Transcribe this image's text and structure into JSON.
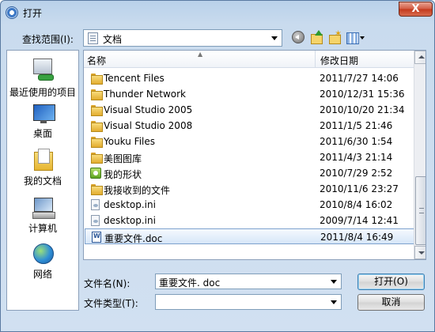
{
  "window": {
    "title": "打开",
    "close_label": "X"
  },
  "toolbar": {
    "look_in_label": "查找范围(I):",
    "look_in_value": "文档",
    "icons": [
      "back-icon",
      "up-folder-icon",
      "new-folder-icon",
      "views-menu-icon"
    ]
  },
  "places": [
    {
      "label": "最近使用的项目",
      "icon": "recent-items-icon"
    },
    {
      "label": "桌面",
      "icon": "desktop-icon"
    },
    {
      "label": "我的文档",
      "icon": "my-documents-icon"
    },
    {
      "label": "计算机",
      "icon": "computer-icon"
    },
    {
      "label": "网络",
      "icon": "network-icon"
    }
  ],
  "file_list": {
    "columns": [
      "名称",
      "修改日期"
    ],
    "rows": [
      {
        "name": "Tencent Files",
        "date": "2011/7/27 14:06",
        "type": "folder"
      },
      {
        "name": "Thunder Network",
        "date": "2010/12/31 15:36",
        "type": "folder"
      },
      {
        "name": "Visual Studio 2005",
        "date": "2010/10/20 21:34",
        "type": "folder"
      },
      {
        "name": "Visual Studio 2008",
        "date": "2011/1/5 21:46",
        "type": "folder"
      },
      {
        "name": "Youku Files",
        "date": "2011/6/30 1:54",
        "type": "folder"
      },
      {
        "name": "美图图库",
        "date": "2011/4/3 21:14",
        "type": "folder"
      },
      {
        "name": "我的形状",
        "date": "2010/7/29 2:52",
        "type": "shapes"
      },
      {
        "name": "我接收到的文件",
        "date": "2010/11/6 23:27",
        "type": "folder"
      },
      {
        "name": "desktop.ini",
        "date": "2010/8/4 16:02",
        "type": "ini"
      },
      {
        "name": "desktop.ini",
        "date": "2009/7/14 12:41",
        "type": "ini"
      },
      {
        "name": "重要文件.doc",
        "date": "2011/8/4 16:49",
        "type": "doc",
        "selected": true
      }
    ]
  },
  "footer": {
    "filename_label": "文件名(N):",
    "filename_value": "重要文件. doc",
    "filetype_label": "文件类型(T):",
    "filetype_value": "",
    "open_label": "打开(O)",
    "cancel_label": "取消"
  }
}
